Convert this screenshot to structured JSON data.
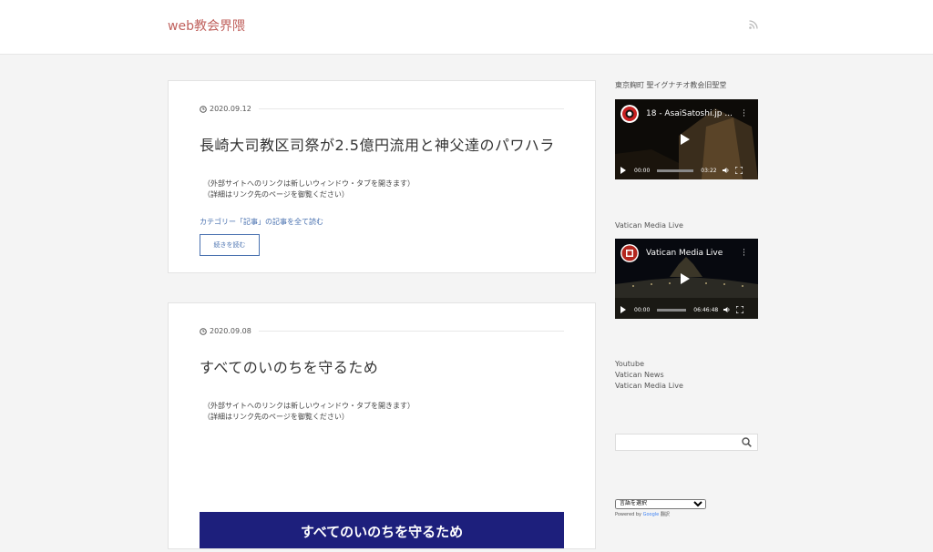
{
  "header": {
    "site_title": "web教会界隈"
  },
  "posts": [
    {
      "date": "2020.09.12",
      "title": "長崎大司教区司祭が2.5億円流用と神父達のパワハラ",
      "note_line1": "（外部サイトへのリンクは新しいウィンドウ・タブを開きます）",
      "note_line2": "（詳細はリンク先のページを御覧ください）",
      "category_link": "カテゴリー「記事」の記事を全て読む",
      "more_label": "続きを読む"
    },
    {
      "date": "2020.09.08",
      "title": "すべてのいのちを守るため",
      "note_line1": "（外部サイトへのリンクは新しいウィンドウ・タブを開きます）",
      "note_line2": "（詳細はリンク先のページを御覧ください）",
      "banner_text": "すべてのいのちを守るため"
    }
  ],
  "sidebar": {
    "video1": {
      "widget_title": "東京麹町 聖イグナチオ教会旧聖堂",
      "video_title": "18 - AsaiSatoshi.jp ...",
      "time_current": "00:00",
      "time_total": "03:22"
    },
    "video2": {
      "widget_title": "Vatican Media Live",
      "video_title": "Vatican Media Live",
      "time_current": "00:00",
      "time_total": "06:46:48"
    },
    "links": [
      "Youtube",
      "Vatican News",
      "Vatican Media Live"
    ],
    "search": {
      "placeholder": ""
    },
    "translate": {
      "select_label": "言語を選択",
      "powered_by": "Powered by",
      "google": "Google",
      "translate_label": "翻訳"
    }
  },
  "colors": {
    "accent": "#c0625e",
    "link": "#4a72b0",
    "banner": "#1d1f7c"
  }
}
